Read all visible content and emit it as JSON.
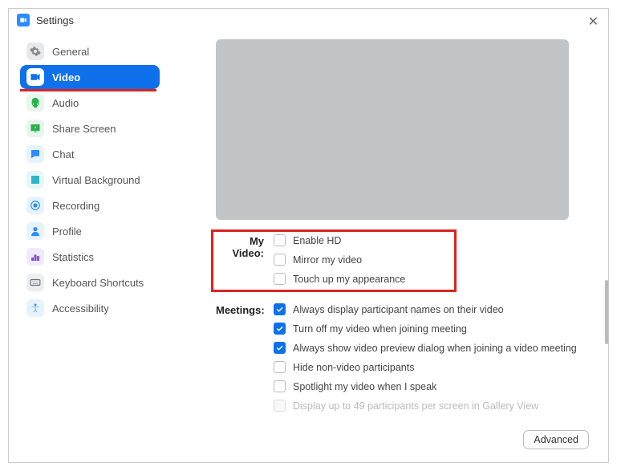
{
  "window": {
    "title": "Settings"
  },
  "sidebar": {
    "items": [
      {
        "label": "General",
        "icon": "gear-icon",
        "bg": "#e8e9ea",
        "fg": "#888"
      },
      {
        "label": "Video",
        "icon": "video-icon",
        "bg": "#ffffff",
        "fg": "#0E71EB",
        "active": true
      },
      {
        "label": "Audio",
        "icon": "audio-icon",
        "bg": "#e6f6ec",
        "fg": "#28b24b"
      },
      {
        "label": "Share Screen",
        "icon": "share-screen-icon",
        "bg": "#e6f6ec",
        "fg": "#28b24b"
      },
      {
        "label": "Chat",
        "icon": "chat-icon",
        "bg": "#e6f3fb",
        "fg": "#2D8CFF"
      },
      {
        "label": "Virtual Background",
        "icon": "virtual-bg-icon",
        "bg": "#e6f7f9",
        "fg": "#2fb6c4"
      },
      {
        "label": "Recording",
        "icon": "recording-icon",
        "bg": "#e6f3fb",
        "fg": "#2D8CFF"
      },
      {
        "label": "Profile",
        "icon": "profile-icon",
        "bg": "#e6f3fb",
        "fg": "#2D8CFF"
      },
      {
        "label": "Statistics",
        "icon": "statistics-icon",
        "bg": "#f1eafc",
        "fg": "#8050d0"
      },
      {
        "label": "Keyboard Shortcuts",
        "icon": "keyboard-icon",
        "bg": "#eceeef",
        "fg": "#6a7178"
      },
      {
        "label": "Accessibility",
        "icon": "accessibility-icon",
        "bg": "#e6f3fb",
        "fg": "#2D8CFF"
      }
    ]
  },
  "video_settings": {
    "my_video_label": "My Video:",
    "my_video_options": [
      {
        "label": "Enable HD",
        "checked": false
      },
      {
        "label": "Mirror my video",
        "checked": false
      },
      {
        "label": "Touch up my appearance",
        "checked": false
      }
    ],
    "meetings_label": "Meetings:",
    "meetings_options": [
      {
        "label": "Always display participant names on their video",
        "checked": true
      },
      {
        "label": "Turn off my video when joining meeting",
        "checked": true
      },
      {
        "label": "Always show video preview dialog when joining a video meeting",
        "checked": true
      },
      {
        "label": "Hide non-video participants",
        "checked": false
      },
      {
        "label": "Spotlight my video when I speak",
        "checked": false
      },
      {
        "label": "Display up to 49 participants per screen in Gallery View",
        "checked": false,
        "disabled": true
      }
    ]
  },
  "advanced_label": "Advanced"
}
